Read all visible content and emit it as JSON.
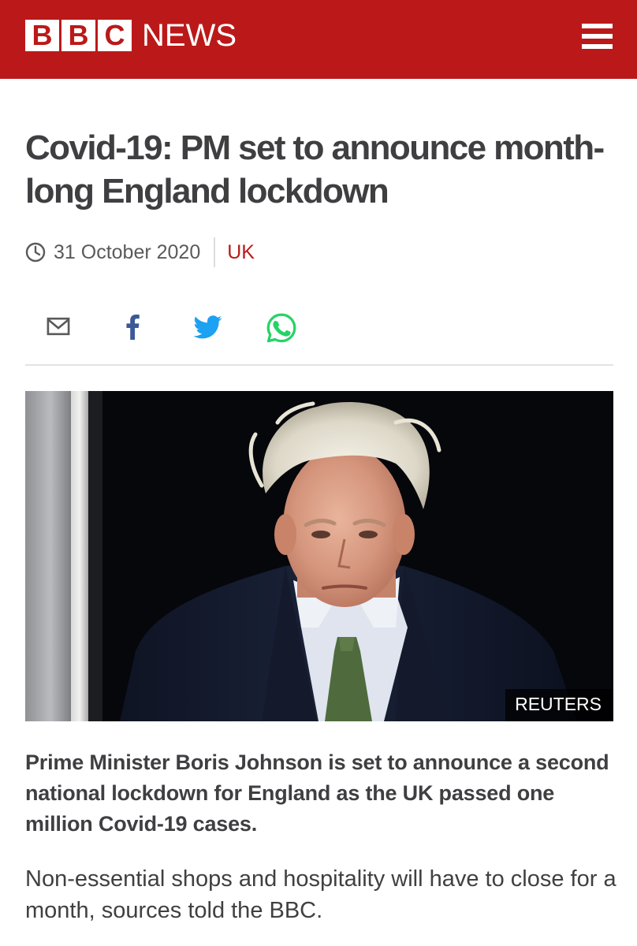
{
  "header": {
    "logo_letters": [
      "B",
      "B",
      "C"
    ],
    "news_label": "NEWS",
    "brand_color": "#bb1919",
    "menu_icon": "hamburger-menu-icon"
  },
  "article": {
    "headline": "Covid-19: PM set to announce month-long England lockdown",
    "date": "31 October 2020",
    "date_icon": "clock-icon",
    "section": "UK",
    "share": [
      {
        "name": "email-share-icon",
        "color": "#5a5a5a"
      },
      {
        "name": "facebook-share-icon",
        "color": "#3b5998"
      },
      {
        "name": "twitter-share-icon",
        "color": "#1da1f2"
      },
      {
        "name": "whatsapp-share-icon",
        "color": "#25d366"
      }
    ],
    "image_credit": "REUTERS",
    "intro": "Prime Minister Boris Johnson is set to announce a second national lockdown for England as the UK passed one million Covid-19 cases.",
    "paragraph": "Non-essential shops and hospitality will have to close for a month, sources told the BBC."
  }
}
